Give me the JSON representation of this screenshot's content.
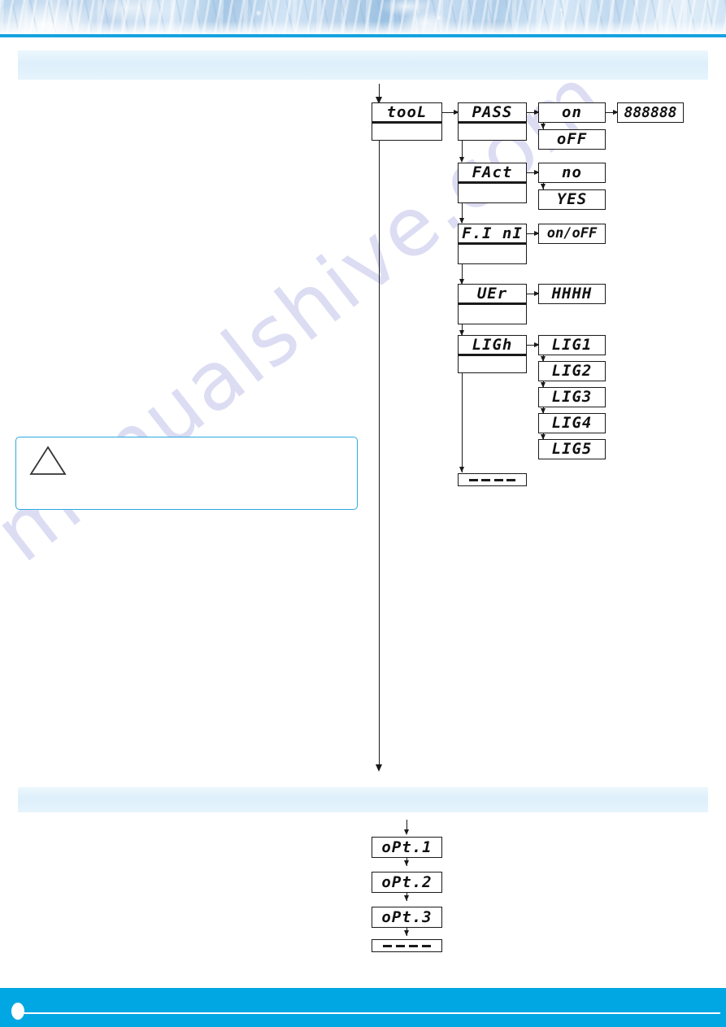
{
  "page": {
    "footer_accent_color": "#00a7e3",
    "header_rule_color": "#14a3e0",
    "banner_color": "#e2f1fb",
    "warning_border_color": "#2aa8e0",
    "watermark_text": "manualshive.com"
  },
  "banners": {
    "top_label": "",
    "middle_label": ""
  },
  "warning": {
    "icon": "warning-triangle-icon",
    "text": ""
  },
  "diagram": {
    "root": {
      "label": "tooL"
    },
    "menu_items": [
      {
        "label": "PASS",
        "options": [
          {
            "label": "on"
          },
          {
            "label": "oFF"
          }
        ],
        "value_display": "888888"
      },
      {
        "label": "FAct",
        "options": [
          {
            "label": "no"
          },
          {
            "label": "YES"
          }
        ]
      },
      {
        "label": "F.I nI",
        "options": [
          {
            "label": "on/oFF"
          }
        ]
      },
      {
        "label": "UEr",
        "options": [
          {
            "label": "HHHH"
          }
        ]
      },
      {
        "label": "LIGh",
        "options": [
          {
            "label": "LIG1"
          },
          {
            "label": "LIG2"
          },
          {
            "label": "LIG3"
          },
          {
            "label": "LIG4"
          },
          {
            "label": "LIG5"
          }
        ]
      }
    ],
    "exit_display": "- - - -",
    "second_group": {
      "items": [
        {
          "label": "oPt.1"
        },
        {
          "label": "oPt.2"
        },
        {
          "label": "oPt.3"
        }
      ],
      "exit_display": "- - - -"
    }
  }
}
